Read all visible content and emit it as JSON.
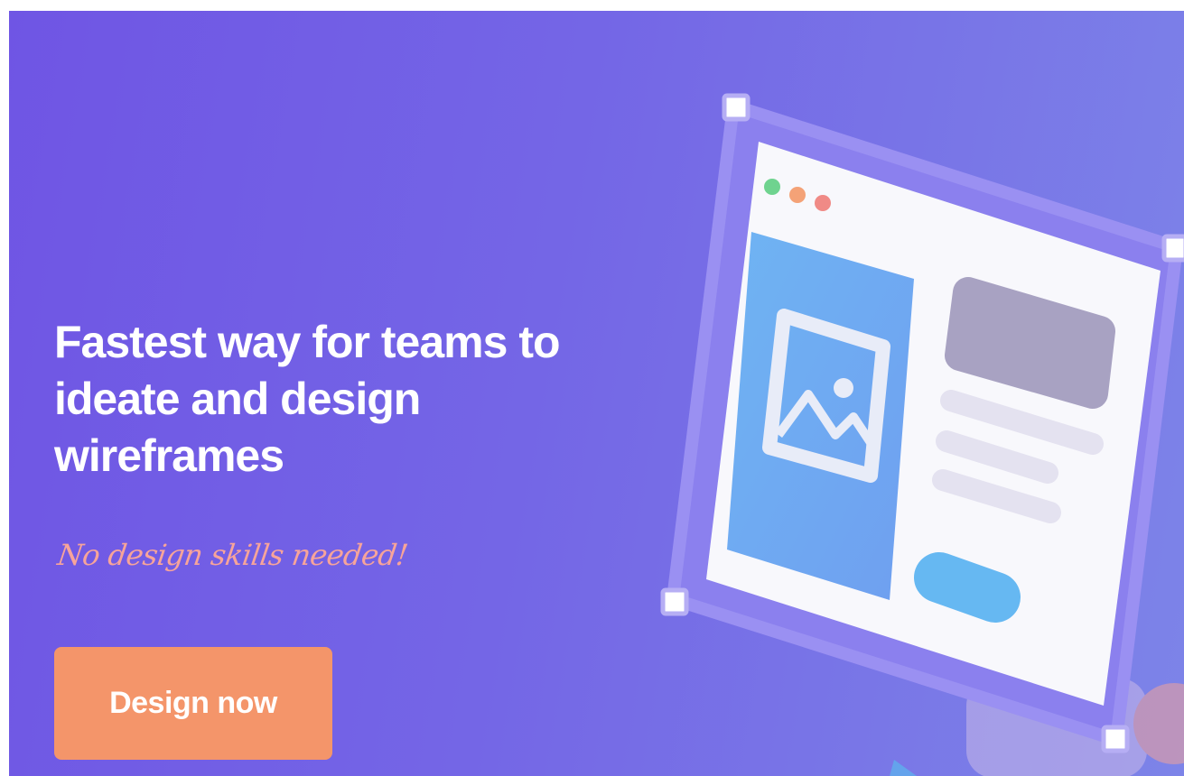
{
  "hero": {
    "headline": "Fastest way for teams to ideate and design wireframes",
    "tagline": "No design skills needed!",
    "cta_label": "Design now"
  },
  "colors": {
    "background_start": "#6f55e4",
    "background_end": "#7d84e8",
    "cta": "#f4956a",
    "tagline": "#f7a49a",
    "dot_green": "#6fd38f",
    "dot_orange": "#f4a277",
    "dot_red": "#f08a86"
  },
  "icons": [
    "image-placeholder-icon",
    "window-dot-icon",
    "resize-handle-icon"
  ]
}
